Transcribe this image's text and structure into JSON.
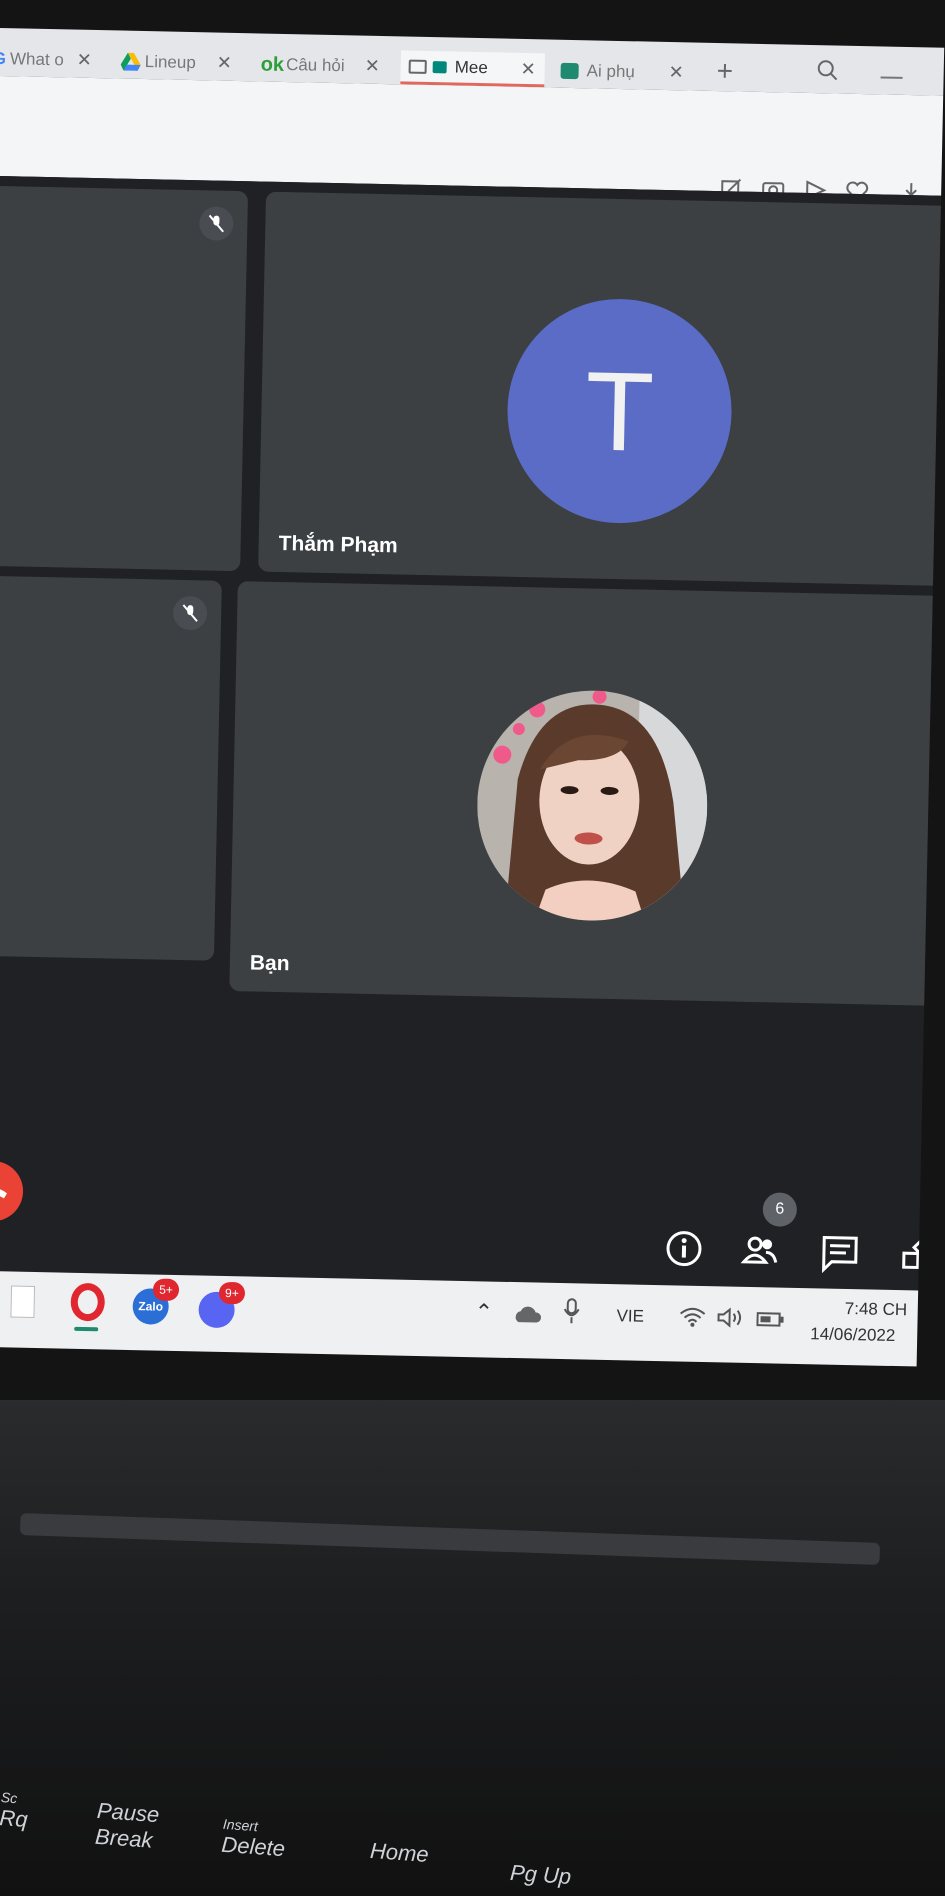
{
  "browser": {
    "tabs": [
      {
        "label": "What o",
        "icon": "google-icon"
      },
      {
        "label": "Lineup",
        "icon": "drive-icon"
      },
      {
        "label": "Câu hỏi",
        "icon": "ok-icon",
        "prefix": "ok"
      },
      {
        "label": "Mee",
        "icon": "meet-icon",
        "active": true
      },
      {
        "label": "Ai phụ",
        "icon": "app-icon"
      }
    ],
    "new_tab": "+"
  },
  "meet": {
    "participants": [
      {
        "name": "",
        "muted": true
      },
      {
        "name": "Thắm Phạm",
        "avatar_letter": "T",
        "avatar_color": "#5b6cc7"
      },
      {
        "name": "",
        "muted": true
      },
      {
        "name": "Bạn",
        "photo": true
      }
    ],
    "participant_count": "6",
    "colors": {
      "tile": "#3c4043",
      "background": "#202124",
      "hangup": "#ea4335"
    }
  },
  "taskbar": {
    "apps": [
      {
        "name": "file-icon"
      },
      {
        "name": "opera-icon"
      },
      {
        "name": "zalo-icon",
        "label": "Zalo",
        "badge": "5+"
      },
      {
        "name": "discord-icon",
        "badge": "9+"
      }
    ],
    "tray": {
      "language": "VIE",
      "time": "7:48 CH",
      "date": "14/06/2022"
    }
  },
  "keyboard": {
    "keys": [
      {
        "top": "Sc",
        "bottom": "Rq"
      },
      {
        "top": "Pause",
        "bottom": "Break"
      },
      {
        "top": "Insert",
        "bottom": "Delete"
      },
      {
        "top": "",
        "bottom": "Home"
      },
      {
        "top": "",
        "bottom": "Pg Up"
      }
    ]
  }
}
